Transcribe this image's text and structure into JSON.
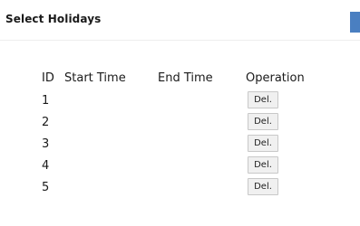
{
  "page": {
    "title": "Select Holidays",
    "accent_color": "#4a7fc1"
  },
  "table": {
    "headers": {
      "id": "ID",
      "start_time": "Start Time",
      "end_time": "End Time",
      "operation": "Operation"
    },
    "rows": [
      {
        "id": "1",
        "start_time": "",
        "end_time": "",
        "action": "Del."
      },
      {
        "id": "2",
        "start_time": "",
        "end_time": "",
        "action": "Del."
      },
      {
        "id": "3",
        "start_time": "",
        "end_time": "",
        "action": "Del."
      },
      {
        "id": "4",
        "start_time": "",
        "end_time": "",
        "action": "Del."
      },
      {
        "id": "5",
        "start_time": "",
        "end_time": "",
        "action": "Del."
      }
    ]
  }
}
